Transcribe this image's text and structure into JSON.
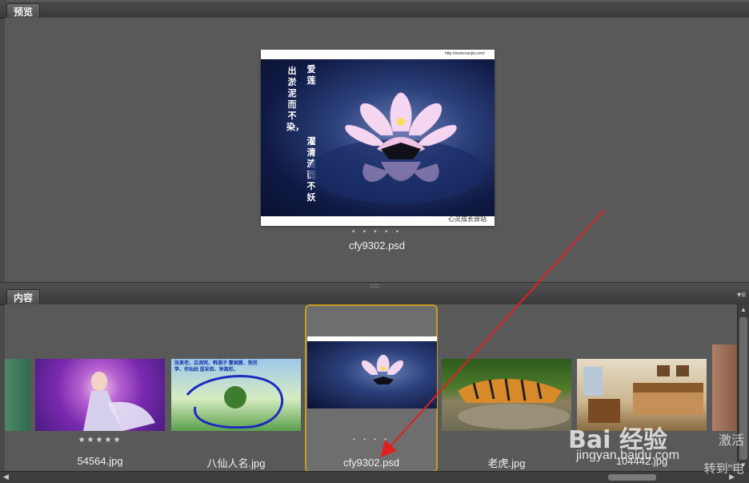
{
  "preview_panel": {
    "tab_label": "预览",
    "image": {
      "url_text": "http://www.nanjia.com/",
      "col1_text": "出淤泥而不染，",
      "col2_text": "濯清涟而不妖",
      "col3_text": "爱莲",
      "brand_text": "心灵成长驿站"
    },
    "rating_dots": "• • • • •",
    "caption": "cfy9302.psd"
  },
  "content_panel": {
    "tab_label": "内容",
    "thumbnails": [
      {
        "name": "",
        "partial": true
      },
      {
        "name": "54564.jpg",
        "stars": "★★★★★"
      },
      {
        "name": "八仙人名.jpg",
        "image_text": "张果老、吕洞宾、韩湘子 曹国舅、铁拐李、何仙姑 蓝采和、钟离权。"
      },
      {
        "name": "cfy9302.psd",
        "selected": true,
        "dots": "• • • •"
      },
      {
        "name": "老虎.jpg"
      },
      {
        "name": "104442.jpg"
      }
    ]
  },
  "watermark": {
    "logo": "Bai 经验",
    "url": "jingyan.baidu.com",
    "side_top": "激活",
    "side_bottom": "转到\"电"
  },
  "colors": {
    "selected_border": "#c89a26",
    "arrow": "#e02020",
    "background": "#595959"
  }
}
